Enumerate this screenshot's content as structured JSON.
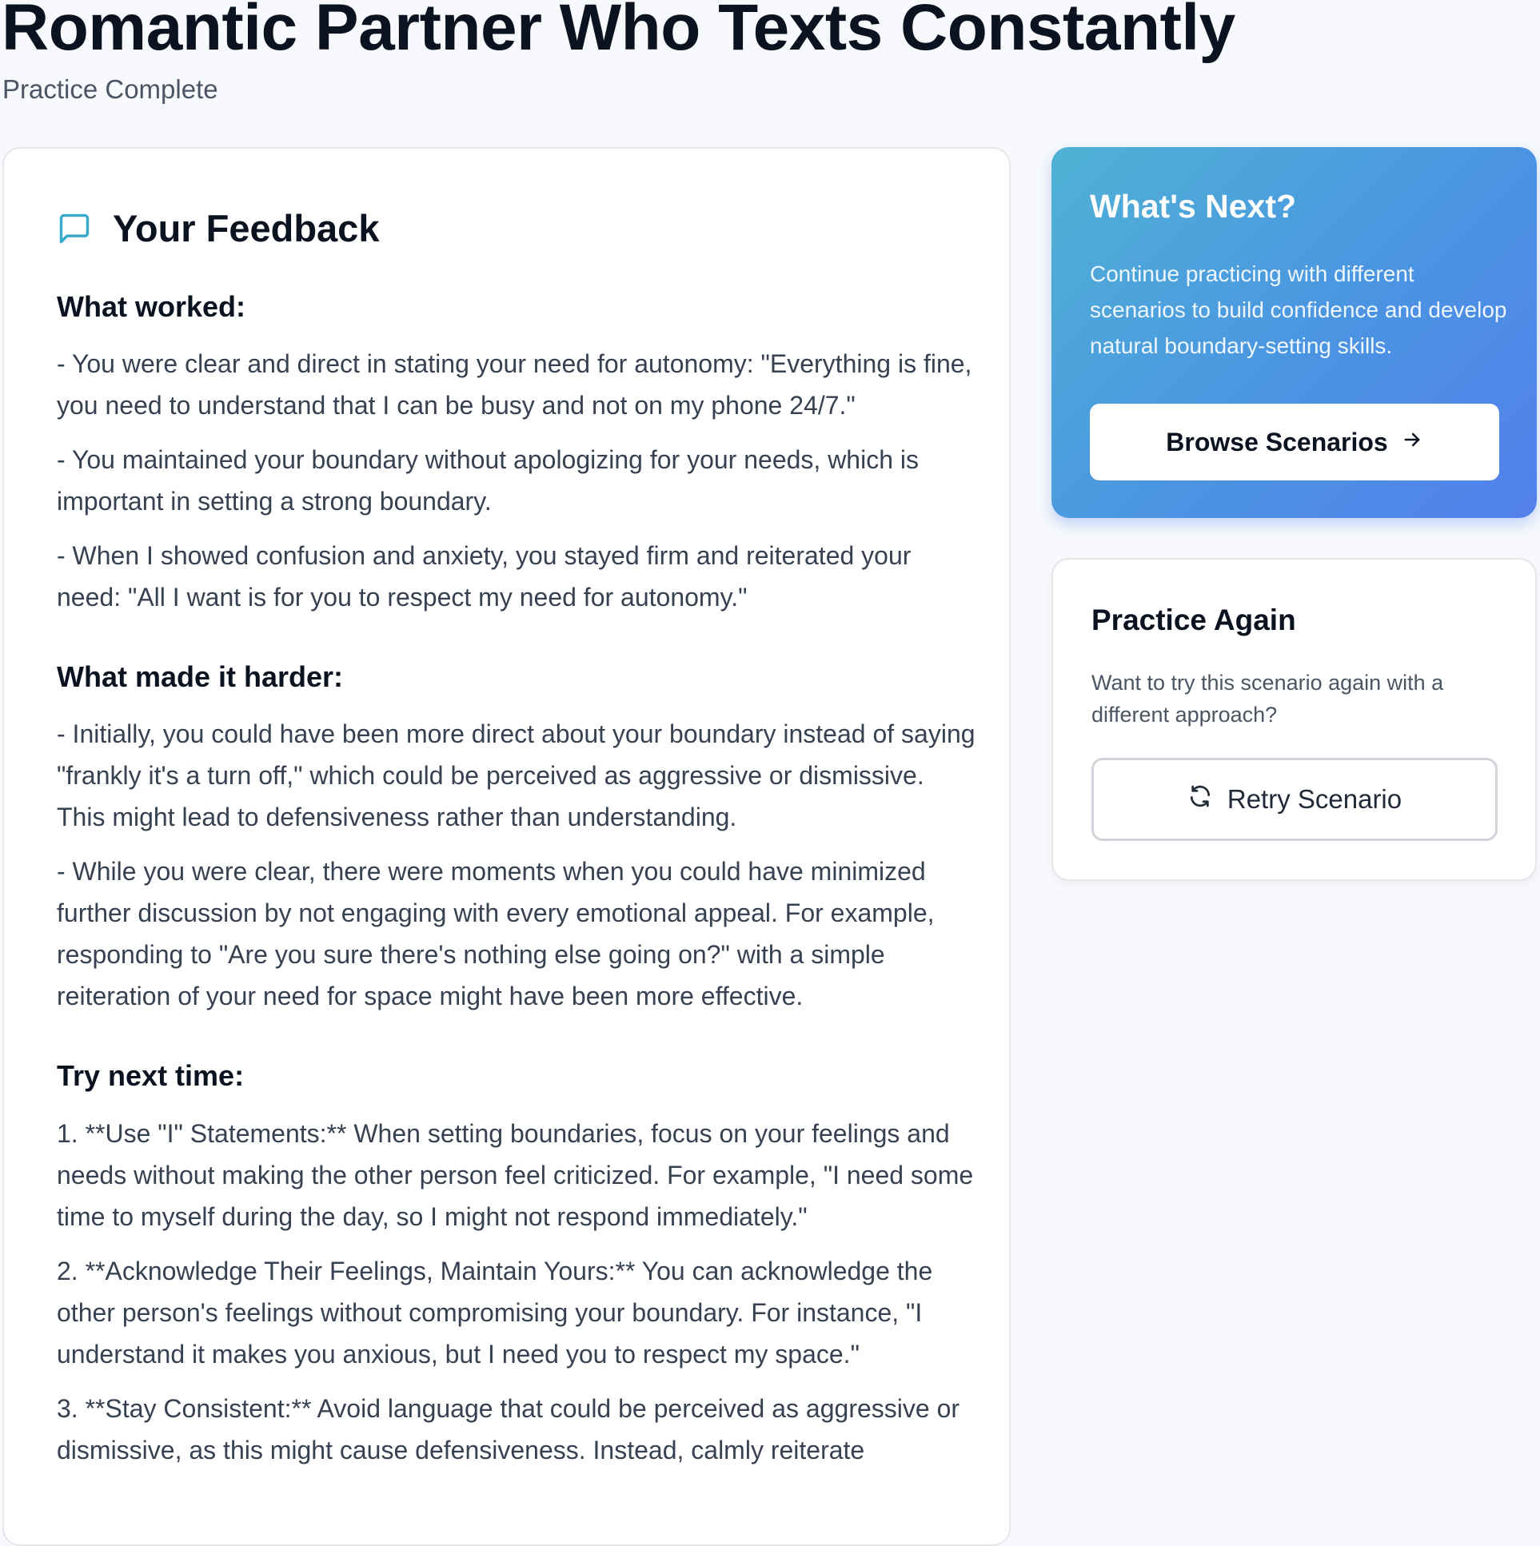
{
  "header": {
    "title": "Romantic Partner Who Texts Constantly",
    "subtitle": "Practice Complete"
  },
  "feedback": {
    "icon": "chat-bubble-icon",
    "title": "Your Feedback",
    "sections": [
      {
        "heading": "What worked:",
        "paragraphs": [
          "- You were clear and direct in stating your need for autonomy: \"Everything is fine, you need to understand that I can be busy and not on my phone 24/7.\"",
          "- You maintained your boundary without apologizing for your needs, which is important in setting a strong boundary.",
          "- When I showed confusion and anxiety, you stayed firm and reiterated your need: \"All I want is for you to respect my need for autonomy.\""
        ]
      },
      {
        "heading": "What made it harder:",
        "paragraphs": [
          "- Initially, you could have been more direct about your boundary instead of saying \"frankly it's a turn off,\" which could be perceived as aggressive or dismissive. This might lead to defensiveness rather than understanding.",
          "- While you were clear, there were moments when you could have minimized further discussion by not engaging with every emotional appeal. For example, responding to \"Are you sure there's nothing else going on?\" with a simple reiteration of your need for space might have been more effective."
        ]
      },
      {
        "heading": "Try next time:",
        "paragraphs": [
          "1. **Use \"I\" Statements:** When setting boundaries, focus on your feelings and needs without making the other person feel criticized. For example, \"I need some time to myself during the day, so I might not respond immediately.\"",
          "2. **Acknowledge Their Feelings, Maintain Yours:** You can acknowledge the other person's feelings without compromising your boundary. For instance, \"I understand it makes you anxious, but I need you to respect my space.\"",
          "3. **Stay Consistent:** Avoid language that could be perceived as aggressive or dismissive, as this might cause defensiveness. Instead, calmly reiterate"
        ]
      }
    ]
  },
  "next": {
    "title": "What's Next?",
    "text": "Continue practicing with different scenarios to build confidence and develop natural boundary-setting skills.",
    "button_label": "Browse Scenarios",
    "button_icon": "arrow-right-icon",
    "gradient_start": "#4fb2d4",
    "gradient_end": "#5280ec"
  },
  "practice": {
    "title": "Practice Again",
    "text": "Want to try this scenario again with a different approach?",
    "button_label": "Retry Scenario",
    "button_icon": "refresh-icon"
  },
  "colors": {
    "accent": "#38a9c9",
    "background": "#f7f9fc"
  }
}
